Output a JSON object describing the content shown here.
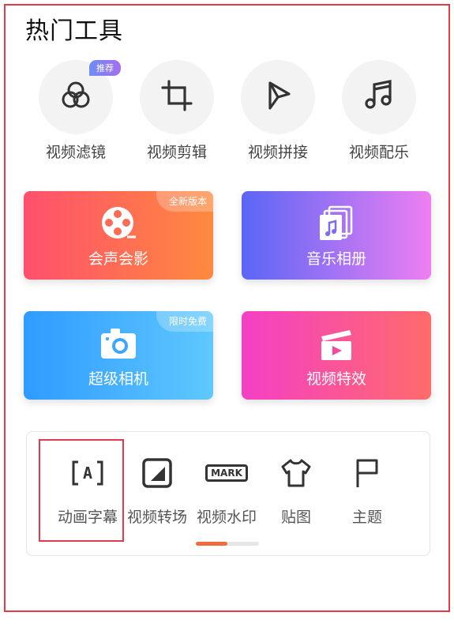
{
  "section_title": "热门工具",
  "top_tools": [
    {
      "label": "视频滤镜",
      "icon": "filter-circles-icon",
      "badge": "推荐"
    },
    {
      "label": "视频剪辑",
      "icon": "crop-icon"
    },
    {
      "label": "视频拼接",
      "icon": "play-merge-icon"
    },
    {
      "label": "视频配乐",
      "icon": "music-note-icon"
    }
  ],
  "cards": [
    {
      "label": "会声会影",
      "icon": "film-reel-icon",
      "badge": "全新版本",
      "colors": [
        "#ff4f6d",
        "#ff8a3d"
      ]
    },
    {
      "label": "音乐相册",
      "icon": "music-album-icon",
      "colors": [
        "#5a66f5",
        "#ee7ff2"
      ]
    },
    {
      "label": "超级相机",
      "icon": "camera-icon",
      "badge": "限时免费",
      "colors": [
        "#2f9bff",
        "#5ec8ff"
      ]
    },
    {
      "label": "视频特效",
      "icon": "clapperboard-icon",
      "colors": [
        "#f43fc6",
        "#ff6b6b"
      ]
    }
  ],
  "strip_tools": [
    {
      "label": "动画字幕",
      "icon": "caption-icon",
      "selected": true
    },
    {
      "label": "视频转场",
      "icon": "transition-icon"
    },
    {
      "label": "视频水印",
      "icon": "watermark-icon",
      "icon_text": "MARK"
    },
    {
      "label": "贴图",
      "icon": "tshirt-sticker-icon"
    },
    {
      "label": "主题",
      "icon": "flag-theme-icon"
    }
  ],
  "caption_icon_text": "A",
  "scroll_progress": 0.5
}
